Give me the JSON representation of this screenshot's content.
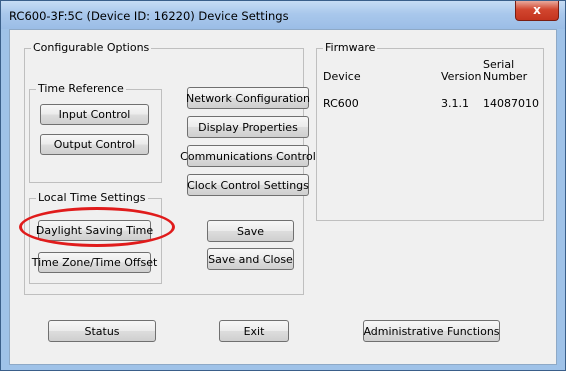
{
  "window": {
    "title": "RC600-3F:5C (Device ID: 16220) Device Settings",
    "close_label": "x"
  },
  "configurable": {
    "label": "Configurable Options",
    "time_reference": {
      "label": "Time Reference",
      "input_control": "Input Control",
      "output_control": "Output Control"
    },
    "local_time": {
      "label": "Local Time Settings",
      "daylight_saving": "Daylight Saving Time",
      "timezone_offset": "Time Zone/Time Offset"
    },
    "network_configuration": "Network Configuration",
    "display_properties": "Display Properties",
    "communications_control": "Communications Control",
    "clock_control_settings": "Clock Control Settings",
    "save": "Save",
    "save_and_close": "Save and Close"
  },
  "firmware": {
    "label": "Firmware",
    "columns": {
      "device": "Device",
      "version": "Version",
      "serial_line1": "Serial",
      "serial_line2": "Number"
    },
    "rows": [
      {
        "device": "RC600",
        "version": "3.1.1",
        "serial": "14087010"
      }
    ]
  },
  "footer": {
    "status": "Status",
    "exit": "Exit",
    "admin": "Administrative Functions"
  },
  "annotation": {
    "color": "#e01b1b",
    "target": "Daylight Saving Time"
  }
}
